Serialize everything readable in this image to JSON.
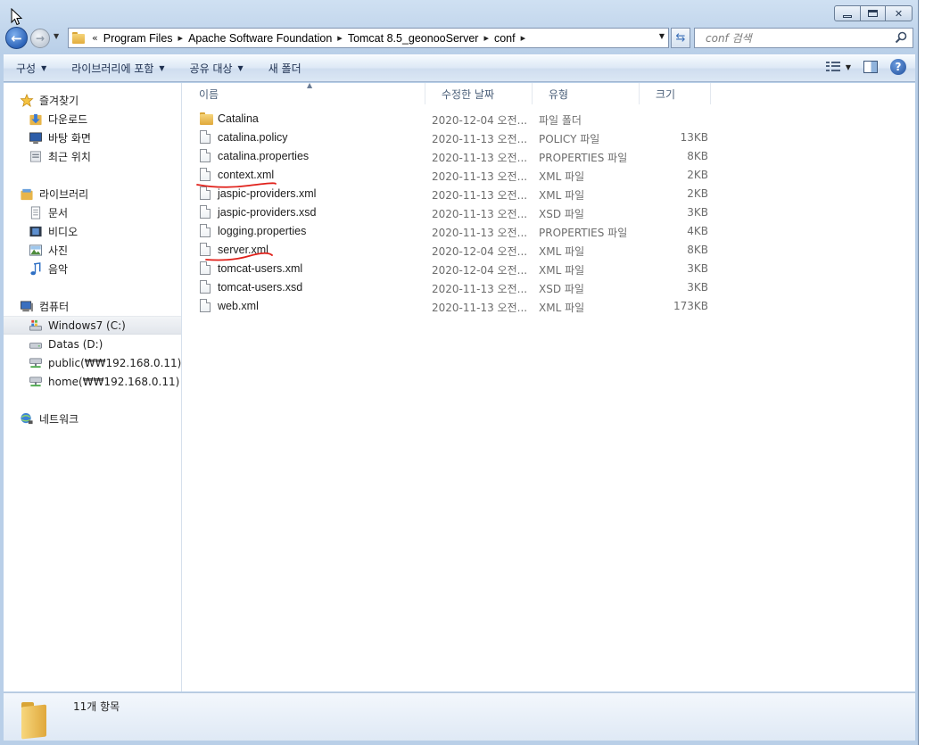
{
  "address": {
    "history_glyph": "«",
    "crumbs": [
      "Program Files",
      "Apache Software Foundation",
      "Tomcat 8.5_geonooServer",
      "conf"
    ],
    "separator": "▸"
  },
  "search": {
    "placeholder": "conf 검색"
  },
  "toolbar": {
    "organize": "구성",
    "include_library": "라이브러리에 포함",
    "share_with": "공유 대상",
    "new_folder": "새 폴더"
  },
  "nav": {
    "favorites": "즐겨찾기",
    "downloads": "다운로드",
    "desktop": "바탕 화면",
    "recent": "최근 위치",
    "libraries": "라이브러리",
    "documents": "문서",
    "videos": "비디오",
    "pictures": "사진",
    "music": "음악",
    "computer": "컴퓨터",
    "drive_c": "Windows7 (C:)",
    "drive_d": "Datas (D:)",
    "drive_y": "public(₩₩192.168.0.11) (Y:)",
    "drive_z": "home(₩₩192.168.0.11) (Z:)",
    "network": "네트워크"
  },
  "columns": {
    "name": "이름",
    "date": "수정한 날짜",
    "type": "유형",
    "size": "크기"
  },
  "files": [
    {
      "name": "Catalina",
      "date": "2020-12-04 오전...",
      "type": "파일 폴더",
      "size": "",
      "icon": "folder-icon"
    },
    {
      "name": "catalina.policy",
      "date": "2020-11-13 오전...",
      "type": "POLICY 파일",
      "size": "13KB",
      "icon": "document-icon"
    },
    {
      "name": "catalina.properties",
      "date": "2020-11-13 오전...",
      "type": "PROPERTIES 파일",
      "size": "8KB",
      "icon": "document-icon"
    },
    {
      "name": "context.xml",
      "date": "2020-11-13 오전...",
      "type": "XML 파일",
      "size": "2KB",
      "icon": "document-icon"
    },
    {
      "name": "jaspic-providers.xml",
      "date": "2020-11-13 오전...",
      "type": "XML 파일",
      "size": "2KB",
      "icon": "document-icon"
    },
    {
      "name": "jaspic-providers.xsd",
      "date": "2020-11-13 오전...",
      "type": "XSD 파일",
      "size": "3KB",
      "icon": "document-icon"
    },
    {
      "name": "logging.properties",
      "date": "2020-11-13 오전...",
      "type": "PROPERTIES 파일",
      "size": "4KB",
      "icon": "document-icon"
    },
    {
      "name": "server.xml",
      "date": "2020-12-04 오전...",
      "type": "XML 파일",
      "size": "8KB",
      "icon": "document-icon"
    },
    {
      "name": "tomcat-users.xml",
      "date": "2020-12-04 오전...",
      "type": "XML 파일",
      "size": "3KB",
      "icon": "document-icon"
    },
    {
      "name": "tomcat-users.xsd",
      "date": "2020-11-13 오전...",
      "type": "XSD 파일",
      "size": "3KB",
      "icon": "document-icon"
    },
    {
      "name": "web.xml",
      "date": "2020-11-13 오전...",
      "type": "XML 파일",
      "size": "173KB",
      "icon": "document-icon"
    }
  ],
  "details": {
    "item_count": "11개 항목"
  },
  "colors": {
    "annotation_underline": "#e0201a",
    "accent": "#1f4f9c"
  }
}
